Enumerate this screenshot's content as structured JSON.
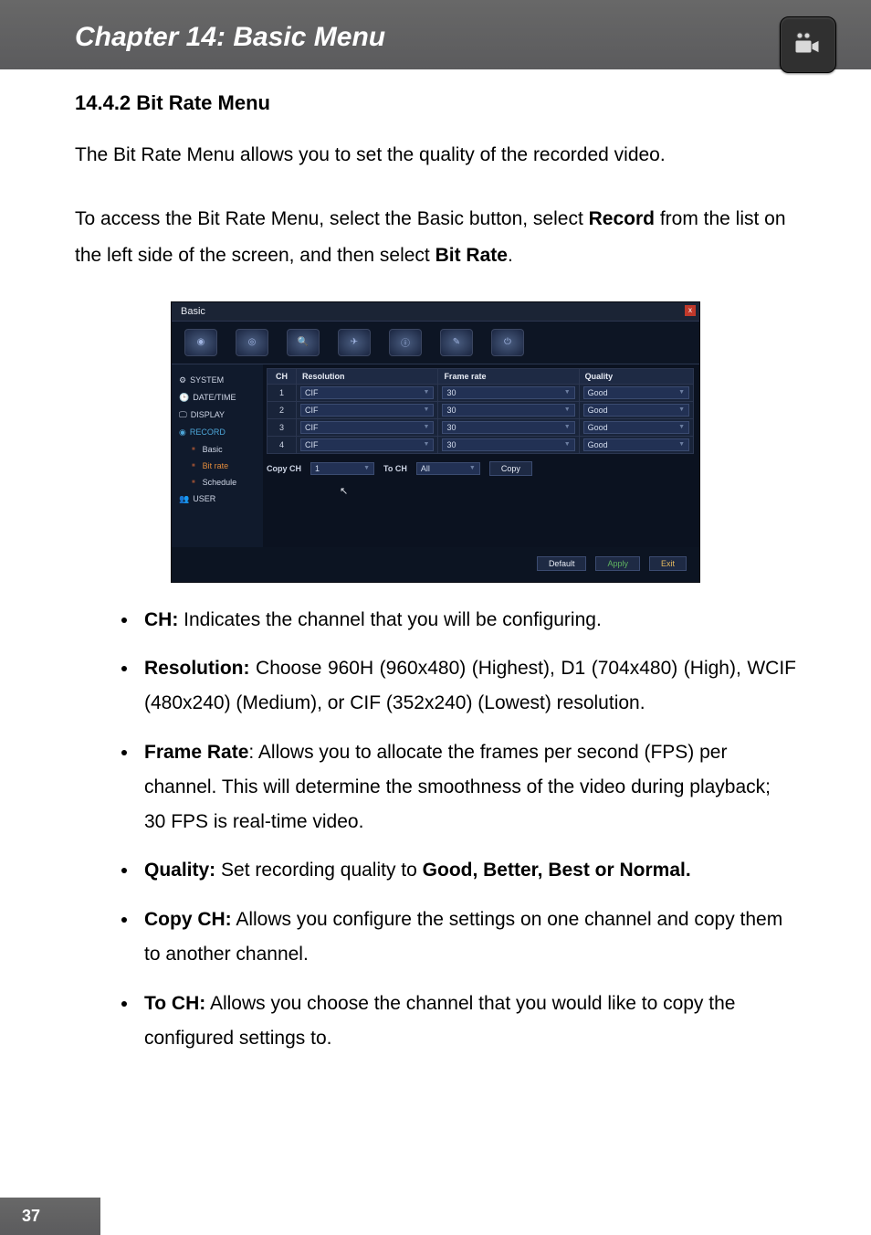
{
  "header": {
    "chapter_title": "Chapter 14: Basic Menu",
    "icon_name": "camcorder-icon"
  },
  "section": {
    "number_title": "14.4.2 Bit Rate Menu",
    "intro": "The Bit Rate Menu allows you to set the quality of the recorded video.",
    "access_pre": "To access the Bit Rate Menu, select the Basic button, select ",
    "access_bold1": "Record",
    "access_mid": " from the list on the left side of the screen, and then select ",
    "access_bold2": "Bit Rate",
    "access_post": "."
  },
  "screenshot": {
    "window_title": "Basic",
    "close_label": "x",
    "sidebar": {
      "items": [
        {
          "label": "SYSTEM",
          "icon": "gear-icon"
        },
        {
          "label": "DATE/TIME",
          "icon": "clock-icon"
        },
        {
          "label": "DISPLAY",
          "icon": "monitor-icon"
        },
        {
          "label": "RECORD",
          "icon": "target-icon",
          "active": true
        }
      ],
      "sub_items": [
        {
          "label": "Basic"
        },
        {
          "label": "Bit rate",
          "selected": true
        },
        {
          "label": "Schedule"
        }
      ],
      "user_label": "USER",
      "user_icon": "users-icon"
    },
    "toolbar_icons": [
      "dashboard-icon",
      "eye-icon",
      "magnifier-icon",
      "plane-icon",
      "info-icon",
      "pen-icon",
      "power-icon"
    ],
    "table": {
      "headers": {
        "ch": "CH",
        "resolution": "Resolution",
        "framerate": "Frame rate",
        "quality": "Quality"
      },
      "rows": [
        {
          "ch": "1",
          "resolution": "CIF",
          "framerate": "30",
          "quality": "Good"
        },
        {
          "ch": "2",
          "resolution": "CIF",
          "framerate": "30",
          "quality": "Good"
        },
        {
          "ch": "3",
          "resolution": "CIF",
          "framerate": "30",
          "quality": "Good"
        },
        {
          "ch": "4",
          "resolution": "CIF",
          "framerate": "30",
          "quality": "Good"
        }
      ]
    },
    "copy_row": {
      "copy_ch_label": "Copy CH",
      "copy_ch_value": "1",
      "to_ch_label": "To CH",
      "to_ch_value": "All",
      "copy_button": "Copy"
    },
    "footer_buttons": {
      "default": "Default",
      "apply": "Apply",
      "exit": "Exit"
    }
  },
  "definitions": [
    {
      "term": "CH:",
      "text": " Indicates the channel that you will be configuring."
    },
    {
      "term": "Resolution:",
      "text": " Choose 960H (960x480) (Highest), D1 (704x480) (High), WCIF (480x240) (Medium), or CIF (352x240) (Lowest) resolution.",
      "justify": true
    },
    {
      "term": "Frame Rate",
      "suffix": ":",
      "text": " Allows you to allocate the frames per second (FPS) per channel. This will determine the smoothness of the video during playback; 30 FPS is real-time video."
    },
    {
      "term": "Quality:",
      "text": " Set recording quality to ",
      "bold_tail": "Good, Better, Best or Normal."
    },
    {
      "term": "Copy CH:",
      "text": " Allows you configure the settings on one channel and copy them to another channel."
    },
    {
      "term": "To CH:",
      "text": " Allows you choose the channel that you would like to copy the configured settings to."
    }
  ],
  "page_number": "37"
}
